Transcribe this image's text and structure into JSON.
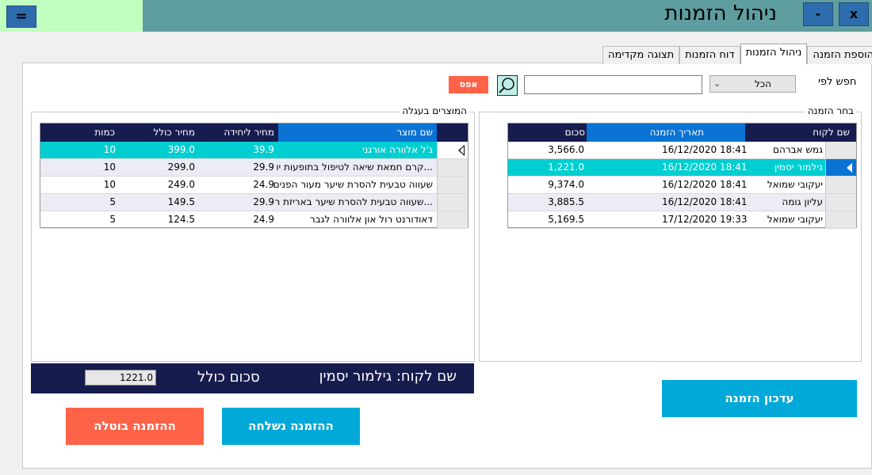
{
  "window": {
    "title": "ניהול הזמנות",
    "menu_label": "=",
    "minimize_label": "-",
    "close_label": "x"
  },
  "tabs": [
    {
      "label": "הוספת הזמנה",
      "active": false
    },
    {
      "label": "ניהול הזמנות",
      "active": true
    },
    {
      "label": "דוח הזמנות",
      "active": false
    },
    {
      "label": "תצוגה מקדימה",
      "active": false
    }
  ],
  "search": {
    "label": "חפש לפי",
    "filter_value": "הכל",
    "input_value": "",
    "reset_label": "אפס"
  },
  "orders": {
    "group_title": "בחר הזמנה",
    "columns": [
      "שם לקוח",
      "תאריך הזמנה",
      "סכום"
    ],
    "rows": [
      {
        "customer": "גמש אברהם",
        "date": "16/12/2020 18:41",
        "amount": "3,566.0"
      },
      {
        "customer": "גילמור יסמין",
        "date": "16/12/2020 18:41",
        "amount": "1,221.0"
      },
      {
        "customer": "יעקובי שמואל",
        "date": "16/12/2020 18:41",
        "amount": "9,374.0"
      },
      {
        "customer": "עליון גומה",
        "date": "16/12/2020 18:41",
        "amount": "3,885.5"
      },
      {
        "customer": "יעקובי שמואל",
        "date": "17/12/2020 19:33",
        "amount": "5,169.5"
      }
    ],
    "selected_index": 1
  },
  "cart": {
    "group_title": "המוצרים בעגלה",
    "columns": [
      "שם מוצר",
      "מחיר ליחידה",
      "מחיר כולל",
      "כמות"
    ],
    "rows": [
      {
        "product": "ג'ל אלוורה אורגני",
        "unit_price": "39.9",
        "total": "399.0",
        "qty": "10"
      },
      {
        "product": "קרם חמאת שיאה לטיפול בתופעות יו...",
        "unit_price": "29.9",
        "total": "299.0",
        "qty": "10"
      },
      {
        "product": "שעווה טבעית להסרת שיער מעור הפנים",
        "unit_price": "24.9",
        "total": "249.0",
        "qty": "10"
      },
      {
        "product": "שעווה טבעית להסרת שיער באריזת ר...",
        "unit_price": "29.9",
        "total": "149.5",
        "qty": "5"
      },
      {
        "product": "דאודורנט רול און אלוורה לגבר",
        "unit_price": "24.9",
        "total": "124.5",
        "qty": "5"
      }
    ],
    "selected_index": 0
  },
  "summary": {
    "customer_text": "שם לקוח: גילמור יסמין",
    "total_label": "סכום כולל",
    "total_value": "1221.0"
  },
  "buttons": {
    "update": "עדכון הזמנה",
    "sent": "ההזמנה נשלחה",
    "cancelled": "ההזמנה בוטלה"
  },
  "colors": {
    "titlebar": "#5f9ea0",
    "header_dark": "#161c4e",
    "header_selected": "#0a73d4",
    "selected_row": "#00ced1",
    "accent_blue": "#00a9d8",
    "accent_red": "#ff6347"
  }
}
